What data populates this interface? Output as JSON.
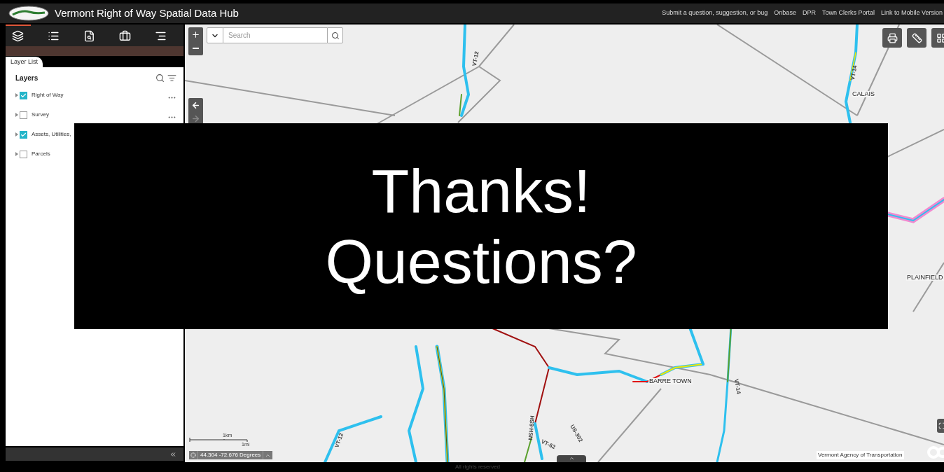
{
  "header": {
    "title": "Vermont Right of Way Spatial Data Hub",
    "links": [
      "Submit a question, suggestion, or bug",
      "Onbase",
      "DPR",
      "Town Clerks Portal",
      "Link to Mobile Version"
    ]
  },
  "toolbar": [
    {
      "kind": "layers",
      "selected": true
    },
    {
      "kind": "list",
      "selected": false
    },
    {
      "kind": "query",
      "selected": false
    },
    {
      "kind": "toolbox",
      "selected": false
    },
    {
      "kind": "legend",
      "selected": false
    }
  ],
  "panel": {
    "tab": "Layer List",
    "heading": "Layers",
    "layers": [
      {
        "label": "Right of Way",
        "checked": true,
        "options_menu": true
      },
      {
        "label": "Survey",
        "checked": false,
        "options_menu": true
      },
      {
        "label": "Assets, Utilities,",
        "checked": true
      },
      {
        "label": "Parcels",
        "checked": false
      }
    ]
  },
  "map": {
    "search": {
      "placeholder": "Search"
    },
    "labels": [
      {
        "text": "VT-12",
        "kind": "route"
      },
      {
        "text": "VT-14",
        "kind": "route"
      },
      {
        "text": "CALAIS",
        "kind": "place"
      },
      {
        "text": "PLAINFIELD",
        "kind": "place"
      },
      {
        "text": "BARRE TOWN",
        "kind": "place"
      },
      {
        "text": "VT-12",
        "kind": "route"
      },
      {
        "text": "NSH-8SH",
        "kind": "route"
      },
      {
        "text": "US-302",
        "kind": "route"
      },
      {
        "text": "VT-62",
        "kind": "route"
      },
      {
        "text": "VT-14",
        "kind": "route"
      }
    ],
    "scale": {
      "metric": "1km",
      "imperial": "1mi"
    },
    "coordinates": "44.304 -72.676 Degrees",
    "attribution": "Vermont Agency of Transportation",
    "footer": "All rights reserved"
  },
  "overlay": {
    "lines": [
      "Thanks!",
      "Questions?"
    ]
  }
}
